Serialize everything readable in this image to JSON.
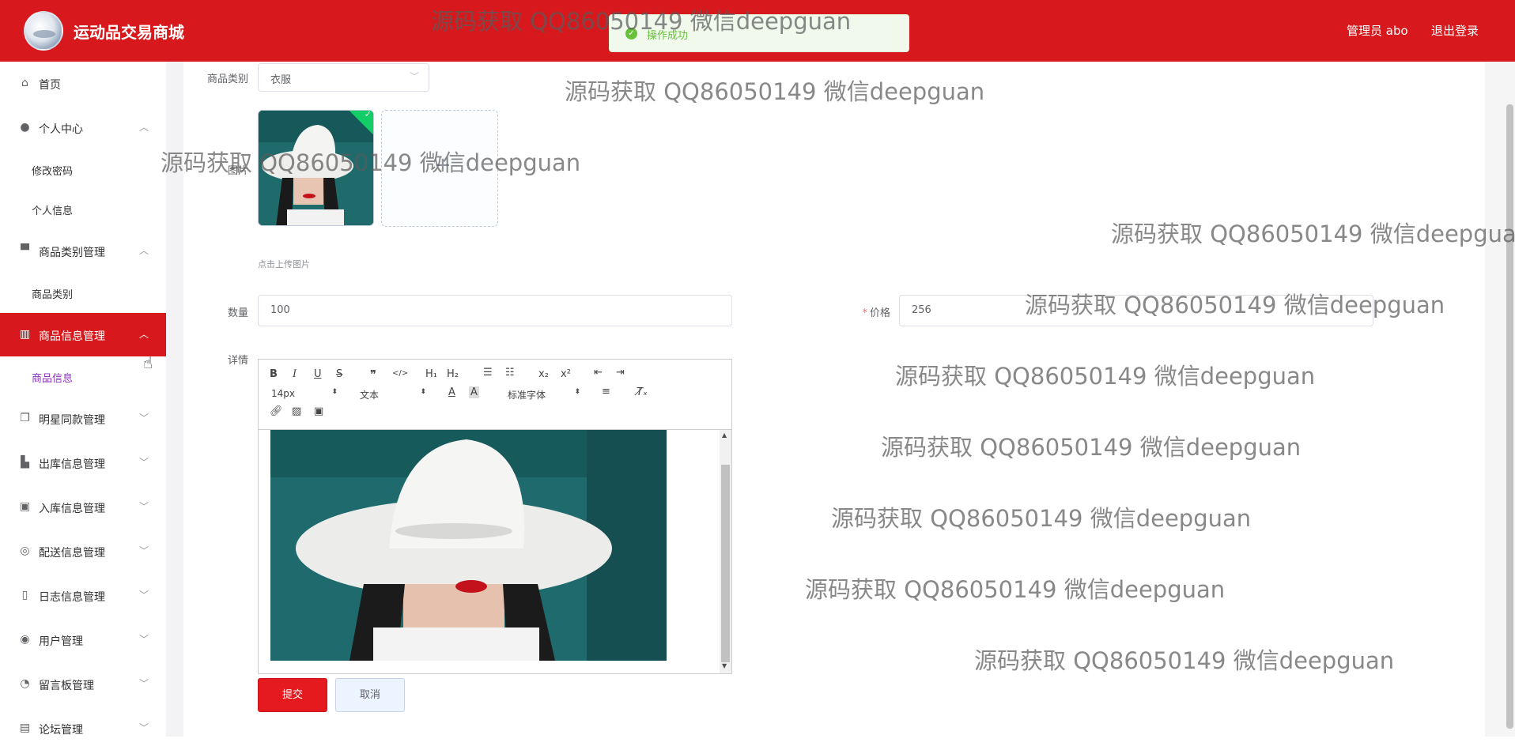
{
  "header": {
    "title": "运动品交易商城",
    "user": "管理员 abo",
    "logout": "退出登录"
  },
  "toast": {
    "icon": "check-circle-icon",
    "message": "操作成功"
  },
  "sidebar": {
    "items": [
      {
        "label": "首页",
        "icon": "home-icon"
      },
      {
        "label": "个人中心",
        "icon": "user-icon",
        "arrow": "chevron-up-icon",
        "children": [
          "修改密码",
          "个人信息"
        ]
      },
      {
        "label": "商品类别管理",
        "icon": "brush-icon",
        "arrow": "chevron-up-icon",
        "children": [
          "商品类别"
        ]
      },
      {
        "label": "商品信息管理",
        "icon": "goods-icon",
        "arrow": "chevron-up-icon",
        "children": [
          "商品信息"
        ]
      },
      {
        "label": "明星同款管理",
        "icon": "copy-icon",
        "arrow": "chevron-down-icon"
      },
      {
        "label": "出库信息管理",
        "icon": "bar-chart-icon",
        "arrow": "chevron-down-icon"
      },
      {
        "label": "入库信息管理",
        "icon": "briefcase-icon",
        "arrow": "chevron-down-icon"
      },
      {
        "label": "配送信息管理",
        "icon": "globe-icon",
        "arrow": "chevron-down-icon"
      },
      {
        "label": "日志信息管理",
        "icon": "phone-icon",
        "arrow": "chevron-down-icon"
      },
      {
        "label": "用户管理",
        "icon": "ring-icon",
        "arrow": "chevron-down-icon"
      },
      {
        "label": "留言板管理",
        "icon": "compass-icon",
        "arrow": "chevron-down-icon"
      },
      {
        "label": "论坛管理",
        "icon": "clipboard-icon",
        "arrow": "chevron-down-icon"
      }
    ],
    "active_item": "商品信息管理",
    "selected_sub": "商品信息"
  },
  "form": {
    "category_label": "商品类别",
    "category_value": "衣服",
    "image_label": "图片",
    "upload_hint": "点击上传图片",
    "quantity_label": "数量",
    "quantity_value": "100",
    "price_label": "价格",
    "price_required_mark": "*",
    "price_value": "256",
    "detail_label": "详情"
  },
  "editor": {
    "toolbar_row1": [
      "B",
      "I",
      "U",
      "S",
      "❞",
      "</>",
      "H₁",
      "H₂",
      "ol",
      "ul",
      "x₂",
      "x²",
      "outdent",
      "indent"
    ],
    "font_size": "14px",
    "block_format": "文本",
    "font_family": "标准字体"
  },
  "buttons": {
    "submit": "提交",
    "cancel": "取消"
  },
  "watermark": "源码获取 QQ86050149 微信deepguan",
  "colors": {
    "brand_red": "#d7191d",
    "success_green": "#67c23a",
    "selected_purple": "#8a36b9"
  }
}
